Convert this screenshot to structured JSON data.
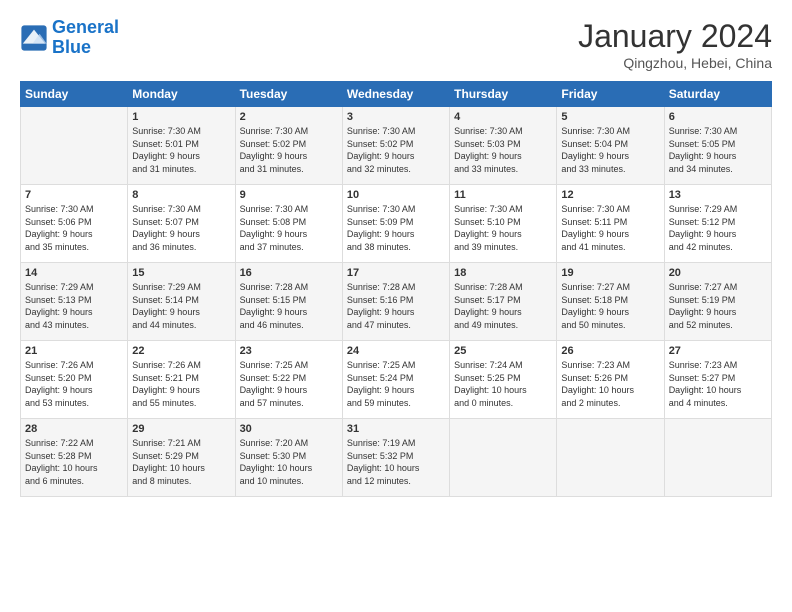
{
  "header": {
    "logo_line1": "General",
    "logo_line2": "Blue",
    "month_title": "January 2024",
    "location": "Qingzhou, Hebei, China"
  },
  "days_of_week": [
    "Sunday",
    "Monday",
    "Tuesday",
    "Wednesday",
    "Thursday",
    "Friday",
    "Saturday"
  ],
  "weeks": [
    [
      {
        "num": "",
        "info": ""
      },
      {
        "num": "1",
        "info": "Sunrise: 7:30 AM\nSunset: 5:01 PM\nDaylight: 9 hours\nand 31 minutes."
      },
      {
        "num": "2",
        "info": "Sunrise: 7:30 AM\nSunset: 5:02 PM\nDaylight: 9 hours\nand 31 minutes."
      },
      {
        "num": "3",
        "info": "Sunrise: 7:30 AM\nSunset: 5:02 PM\nDaylight: 9 hours\nand 32 minutes."
      },
      {
        "num": "4",
        "info": "Sunrise: 7:30 AM\nSunset: 5:03 PM\nDaylight: 9 hours\nand 33 minutes."
      },
      {
        "num": "5",
        "info": "Sunrise: 7:30 AM\nSunset: 5:04 PM\nDaylight: 9 hours\nand 33 minutes."
      },
      {
        "num": "6",
        "info": "Sunrise: 7:30 AM\nSunset: 5:05 PM\nDaylight: 9 hours\nand 34 minutes."
      }
    ],
    [
      {
        "num": "7",
        "info": "Sunrise: 7:30 AM\nSunset: 5:06 PM\nDaylight: 9 hours\nand 35 minutes."
      },
      {
        "num": "8",
        "info": "Sunrise: 7:30 AM\nSunset: 5:07 PM\nDaylight: 9 hours\nand 36 minutes."
      },
      {
        "num": "9",
        "info": "Sunrise: 7:30 AM\nSunset: 5:08 PM\nDaylight: 9 hours\nand 37 minutes."
      },
      {
        "num": "10",
        "info": "Sunrise: 7:30 AM\nSunset: 5:09 PM\nDaylight: 9 hours\nand 38 minutes."
      },
      {
        "num": "11",
        "info": "Sunrise: 7:30 AM\nSunset: 5:10 PM\nDaylight: 9 hours\nand 39 minutes."
      },
      {
        "num": "12",
        "info": "Sunrise: 7:30 AM\nSunset: 5:11 PM\nDaylight: 9 hours\nand 41 minutes."
      },
      {
        "num": "13",
        "info": "Sunrise: 7:29 AM\nSunset: 5:12 PM\nDaylight: 9 hours\nand 42 minutes."
      }
    ],
    [
      {
        "num": "14",
        "info": "Sunrise: 7:29 AM\nSunset: 5:13 PM\nDaylight: 9 hours\nand 43 minutes."
      },
      {
        "num": "15",
        "info": "Sunrise: 7:29 AM\nSunset: 5:14 PM\nDaylight: 9 hours\nand 44 minutes."
      },
      {
        "num": "16",
        "info": "Sunrise: 7:28 AM\nSunset: 5:15 PM\nDaylight: 9 hours\nand 46 minutes."
      },
      {
        "num": "17",
        "info": "Sunrise: 7:28 AM\nSunset: 5:16 PM\nDaylight: 9 hours\nand 47 minutes."
      },
      {
        "num": "18",
        "info": "Sunrise: 7:28 AM\nSunset: 5:17 PM\nDaylight: 9 hours\nand 49 minutes."
      },
      {
        "num": "19",
        "info": "Sunrise: 7:27 AM\nSunset: 5:18 PM\nDaylight: 9 hours\nand 50 minutes."
      },
      {
        "num": "20",
        "info": "Sunrise: 7:27 AM\nSunset: 5:19 PM\nDaylight: 9 hours\nand 52 minutes."
      }
    ],
    [
      {
        "num": "21",
        "info": "Sunrise: 7:26 AM\nSunset: 5:20 PM\nDaylight: 9 hours\nand 53 minutes."
      },
      {
        "num": "22",
        "info": "Sunrise: 7:26 AM\nSunset: 5:21 PM\nDaylight: 9 hours\nand 55 minutes."
      },
      {
        "num": "23",
        "info": "Sunrise: 7:25 AM\nSunset: 5:22 PM\nDaylight: 9 hours\nand 57 minutes."
      },
      {
        "num": "24",
        "info": "Sunrise: 7:25 AM\nSunset: 5:24 PM\nDaylight: 9 hours\nand 59 minutes."
      },
      {
        "num": "25",
        "info": "Sunrise: 7:24 AM\nSunset: 5:25 PM\nDaylight: 10 hours\nand 0 minutes."
      },
      {
        "num": "26",
        "info": "Sunrise: 7:23 AM\nSunset: 5:26 PM\nDaylight: 10 hours\nand 2 minutes."
      },
      {
        "num": "27",
        "info": "Sunrise: 7:23 AM\nSunset: 5:27 PM\nDaylight: 10 hours\nand 4 minutes."
      }
    ],
    [
      {
        "num": "28",
        "info": "Sunrise: 7:22 AM\nSunset: 5:28 PM\nDaylight: 10 hours\nand 6 minutes."
      },
      {
        "num": "29",
        "info": "Sunrise: 7:21 AM\nSunset: 5:29 PM\nDaylight: 10 hours\nand 8 minutes."
      },
      {
        "num": "30",
        "info": "Sunrise: 7:20 AM\nSunset: 5:30 PM\nDaylight: 10 hours\nand 10 minutes."
      },
      {
        "num": "31",
        "info": "Sunrise: 7:19 AM\nSunset: 5:32 PM\nDaylight: 10 hours\nand 12 minutes."
      },
      {
        "num": "",
        "info": ""
      },
      {
        "num": "",
        "info": ""
      },
      {
        "num": "",
        "info": ""
      }
    ]
  ]
}
